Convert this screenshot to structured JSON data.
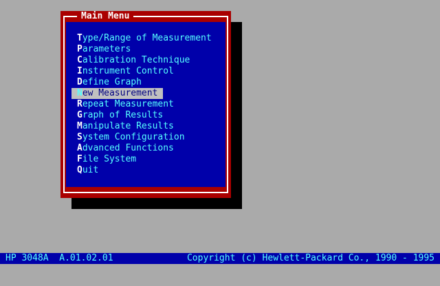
{
  "menu": {
    "title": "Main Menu",
    "items": [
      {
        "hotkey": "T",
        "rest": "ype/Range of Measurement"
      },
      {
        "hotkey": "P",
        "rest": "arameters"
      },
      {
        "hotkey": "C",
        "rest": "alibration Technique"
      },
      {
        "hotkey": "I",
        "rest": "nstrument Control"
      },
      {
        "hotkey": "D",
        "rest": "efine Graph"
      },
      {
        "hotkey": "N",
        "rest": "ew Measurement"
      },
      {
        "hotkey": "R",
        "rest": "epeat Measurement"
      },
      {
        "hotkey": "G",
        "rest": "raph of Results"
      },
      {
        "hotkey": "M",
        "rest": "anipulate Results"
      },
      {
        "hotkey": "S",
        "rest": "ystem Configuration"
      },
      {
        "hotkey": "A",
        "rest": "dvanced Functions"
      },
      {
        "hotkey": "F",
        "rest": "ile System"
      },
      {
        "hotkey": "Q",
        "rest": "uit"
      }
    ]
  },
  "status_bar": {
    "left": "HP 3048A  A.01.02.01",
    "right": "Copyright (c) Hewlett-Packard Co., 1990 - 1995"
  },
  "colors": {
    "desktop": "#aaaaaa",
    "menu_frame": "#aa0000",
    "menu_panel": "#0000aa",
    "item_text": "#55ffff",
    "hotkey_text": "#ffffff",
    "selected_bg": "#c0c0c0"
  }
}
